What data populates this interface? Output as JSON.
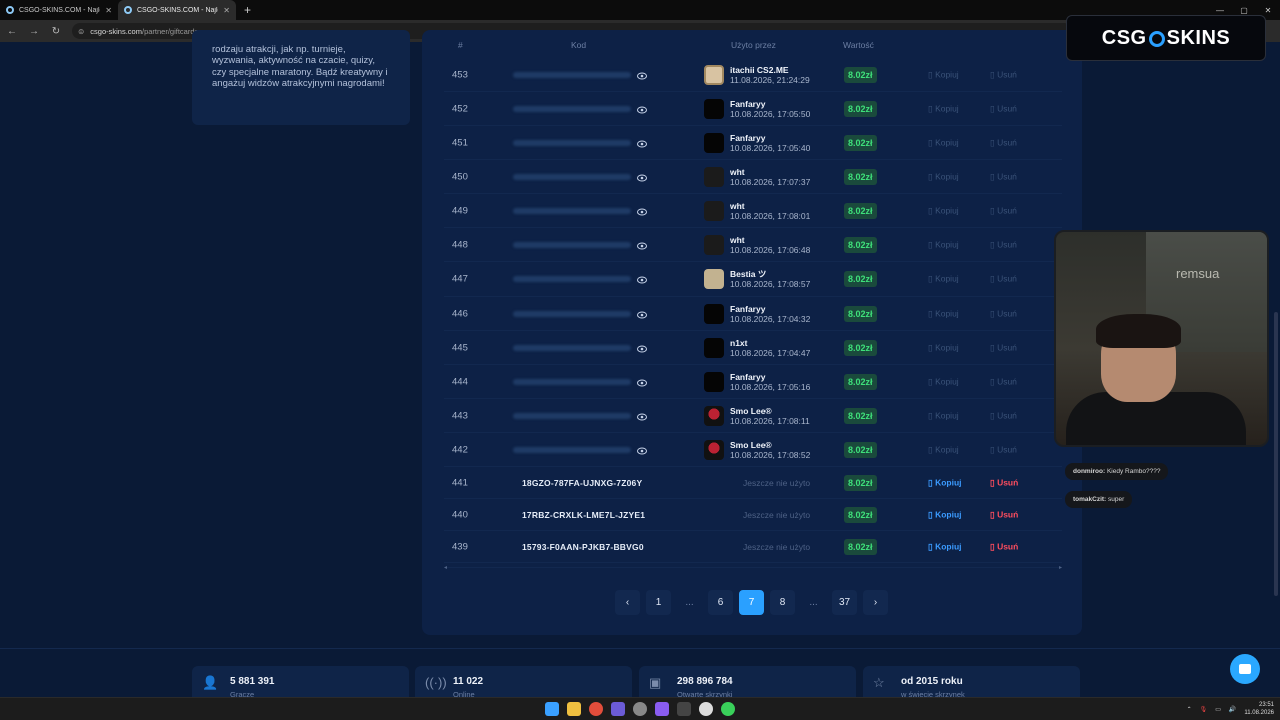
{
  "browser": {
    "tabs": [
      {
        "title": "CSGO-SKINS.COM - Najlepsze"
      },
      {
        "title": "CSGO-SKINS.COM - Najlepsze"
      }
    ],
    "url_host": "csgo-skins.com",
    "url_path": "/partner/giftcards"
  },
  "left_card": {
    "text": "rodzaju atrakcji, jak np. turnieje, wyzwania, aktywność na czacie, quizy, czy specjalne maratony. Bądź kreatywny i angażuj widzów atrakcyjnymi nagrodami!"
  },
  "table": {
    "headers": {
      "num": "#",
      "code": "Kod",
      "used_by": "Użyto przez",
      "value": "Wartość"
    },
    "copy_label": "Kopiuj",
    "delete_label": "Usuń",
    "unused_label": "Jeszcze nie użyto",
    "used_rows": [
      {
        "num": "453",
        "user": "itachii CS2.ME",
        "date": "11.08.2026, 21:24:29",
        "value": "8.02zł"
      },
      {
        "num": "452",
        "user": "Fanfaryy",
        "date": "10.08.2026, 17:05:50",
        "value": "8.02zł"
      },
      {
        "num": "451",
        "user": "Fanfaryy",
        "date": "10.08.2026, 17:05:40",
        "value": "8.02zł"
      },
      {
        "num": "450",
        "user": "wht",
        "date": "10.08.2026, 17:07:37",
        "value": "8.02zł"
      },
      {
        "num": "449",
        "user": "wht",
        "date": "10.08.2026, 17:08:01",
        "value": "8.02zł"
      },
      {
        "num": "448",
        "user": "wht",
        "date": "10.08.2026, 17:06:48",
        "value": "8.02zł"
      },
      {
        "num": "447",
        "user": "Bestia ツ",
        "date": "10.08.2026, 17:08:57",
        "value": "8.02zł"
      },
      {
        "num": "446",
        "user": "Fanfaryy",
        "date": "10.08.2026, 17:04:32",
        "value": "8.02zł"
      },
      {
        "num": "445",
        "user": "n1xt",
        "date": "10.08.2026, 17:04:47",
        "value": "8.02zł"
      },
      {
        "num": "444",
        "user": "Fanfaryy",
        "date": "10.08.2026, 17:05:16",
        "value": "8.02zł"
      },
      {
        "num": "443",
        "user": "Smo Lee®",
        "date": "10.08.2026, 17:08:11",
        "value": "8.02zł"
      },
      {
        "num": "442",
        "user": "Smo Lee®",
        "date": "10.08.2026, 17:08:52",
        "value": "8.02zł"
      }
    ],
    "unused_rows": [
      {
        "num": "441",
        "code": "18GZO-787FA-UJNXG-7Z06Y",
        "value": "8.02zł"
      },
      {
        "num": "440",
        "code": "17RBZ-CRXLK-LME7L-JZYE1",
        "value": "8.02zł"
      },
      {
        "num": "439",
        "code": "15793-F0AAN-PJKB7-BBVG0",
        "value": "8.02zł"
      }
    ]
  },
  "pagination": {
    "prev": "‹",
    "pages": [
      "1",
      "...",
      "6",
      "7",
      "8",
      "...",
      "37"
    ],
    "current": "7",
    "next": "›"
  },
  "stats": [
    {
      "icon": "user-icon",
      "value": "5 881 391",
      "label": "Gracze"
    },
    {
      "icon": "broadcast-icon",
      "value": "11 022",
      "label": "Online"
    },
    {
      "icon": "case-icon",
      "value": "298 896 784",
      "label": "Otwarte skrzynki"
    },
    {
      "icon": "star-icon",
      "value": "od 2015 roku",
      "label": "w świecie skrzynek"
    }
  ],
  "logo": {
    "left": "CSG",
    "right": "SKINS"
  },
  "webcam": {
    "sign": "remsua"
  },
  "chat": [
    {
      "name": "donmiroo:",
      "text": "Kiedy Rambo????"
    },
    {
      "name": "tomakCzit:",
      "text": "super"
    }
  ],
  "taskbar": {
    "time": "23:51",
    "date": "11.08.2026"
  },
  "colors": {
    "accent": "#2aa0ff",
    "value_green": "#3ee07a",
    "delete_red": "#ff4d5e",
    "panel": "#0d2146"
  }
}
